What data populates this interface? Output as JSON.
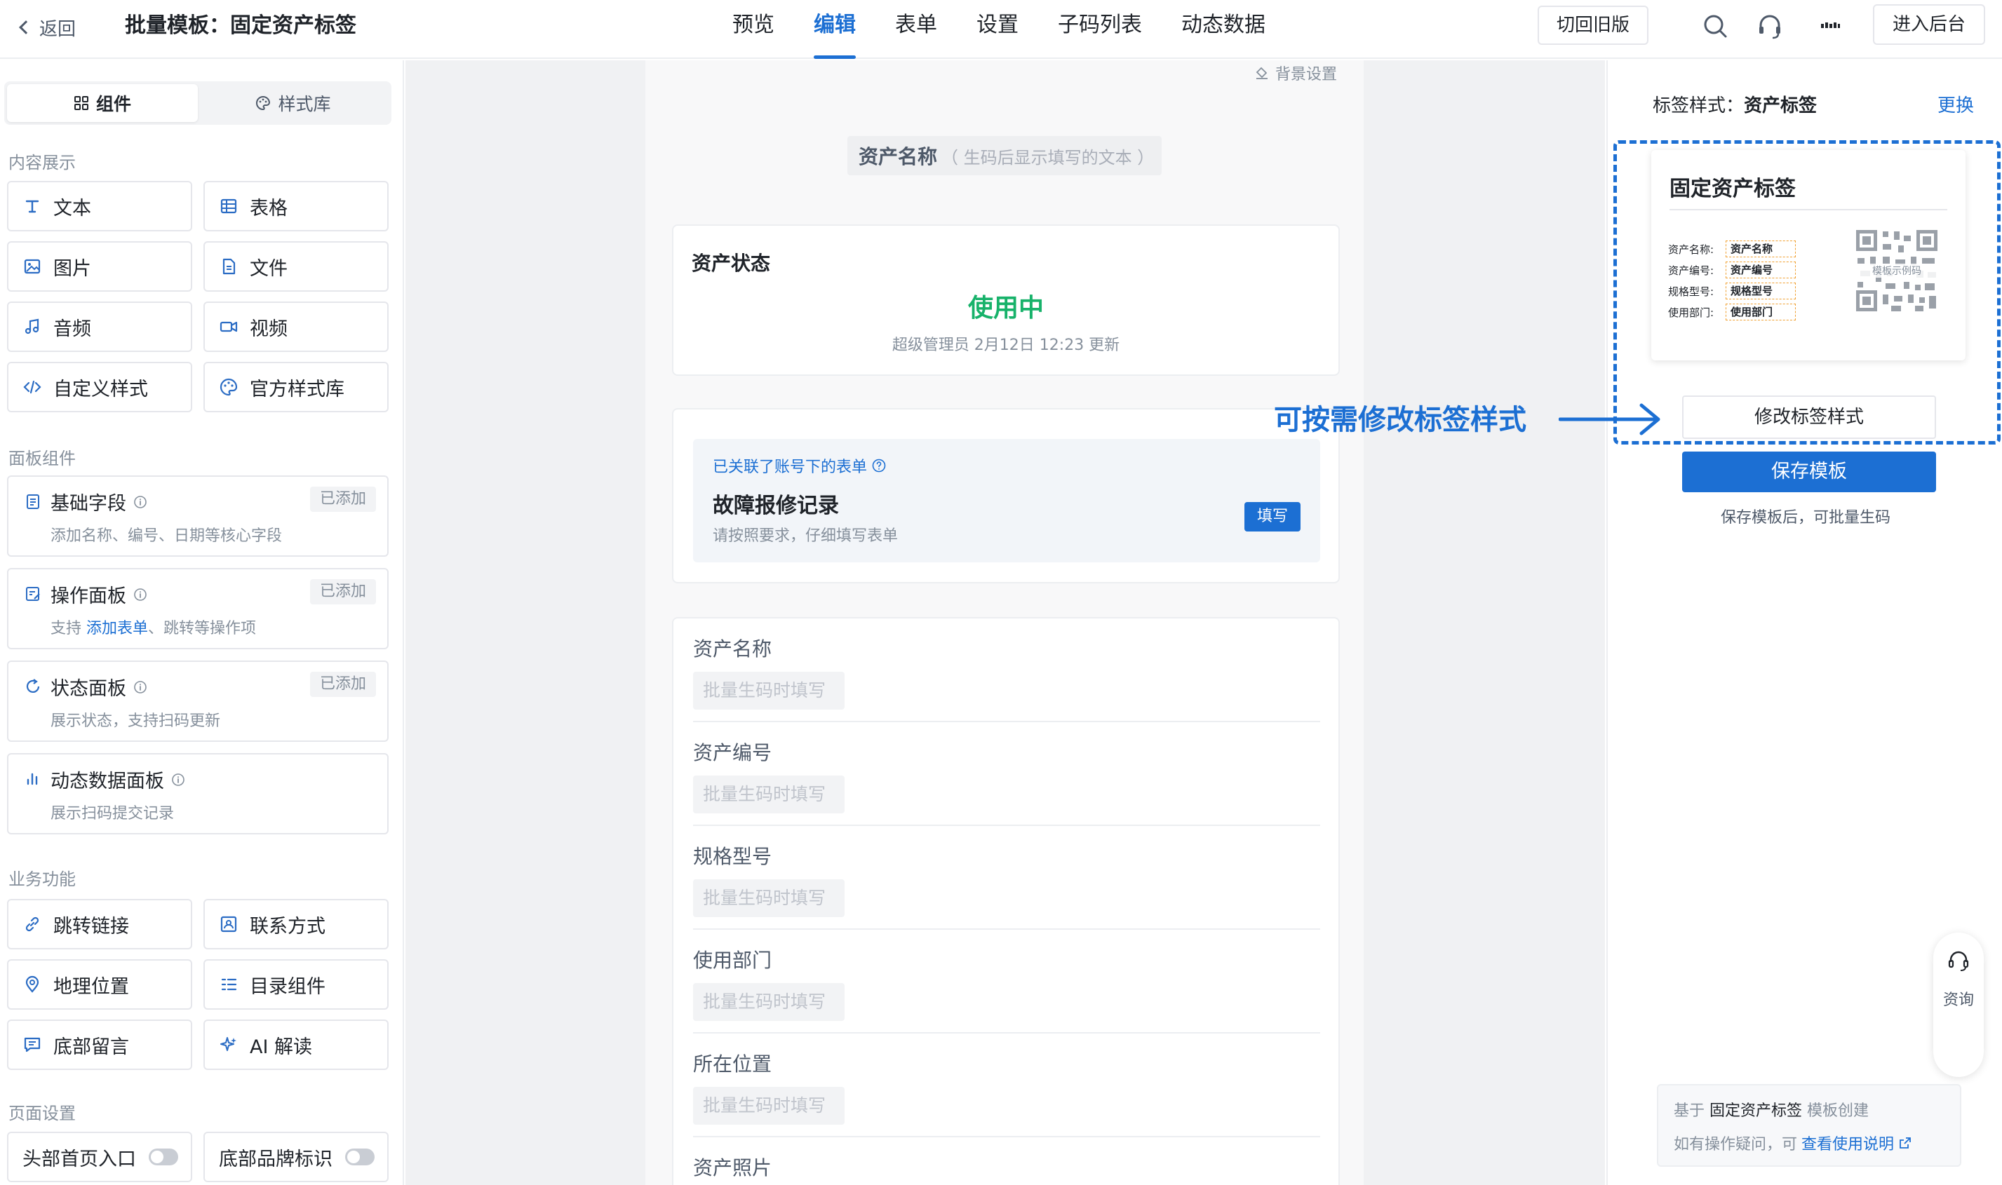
{
  "header": {
    "back_label": "返回",
    "title": "批量模板：固定资产标签",
    "tabs": [
      "预览",
      "编辑",
      "表单",
      "设置",
      "子码列表",
      "动态数据"
    ],
    "active_tab": "编辑",
    "old_version_label": "切回旧版",
    "admin_label": "进入后台"
  },
  "sidebar": {
    "tabs": {
      "components": "组件",
      "style_library": "样式库"
    },
    "sections": {
      "content": "内容展示",
      "panels": "面板组件",
      "business": "业务功能",
      "page": "页面设置"
    },
    "content_items": [
      "文本",
      "表格",
      "图片",
      "文件",
      "音频",
      "视频",
      "自定义样式",
      "官方样式库"
    ],
    "panel_items": [
      {
        "title": "基础字段",
        "desc": "添加名称、编号、日期等核心字段",
        "tag": "已添加"
      },
      {
        "title": "操作面板",
        "desc_prefix": "支持 ",
        "desc_link": "添加表单",
        "desc_suffix": "、跳转等操作项",
        "tag": "已添加"
      },
      {
        "title": "状态面板",
        "desc": "展示状态，支持扫码更新",
        "tag": "已添加"
      },
      {
        "title": "动态数据面板",
        "desc": "展示扫码提交记录",
        "tag": ""
      }
    ],
    "business_items": [
      "跳转链接",
      "联系方式",
      "地理位置",
      "目录组件",
      "底部留言",
      "AI 解读"
    ],
    "page_items": [
      "头部首页入口",
      "底部品牌标识"
    ]
  },
  "canvas": {
    "bg_setting": "背景设置",
    "name_chip": {
      "label": "资产名称",
      "hint": "（ 生码后显示填写的文本 ）"
    },
    "status": {
      "title": "资产状态",
      "value": "使用中",
      "meta": "超级管理员 2月12日 12:23 更新",
      "value_color": "#17b26a"
    },
    "form": {
      "linked": "已关联了账号下的表单",
      "name": "故障报修记录",
      "desc": "请按照要求，仔细填写表单",
      "button": "填写"
    },
    "fields": [
      {
        "label": "资产名称",
        "placeholder": "批量生码时填写"
      },
      {
        "label": "资产编号",
        "placeholder": "批量生码时填写"
      },
      {
        "label": "规格型号",
        "placeholder": "批量生码时填写"
      },
      {
        "label": "使用部门",
        "placeholder": "批量生码时填写"
      },
      {
        "label": "所在位置",
        "placeholder": "批量生码时填写"
      },
      {
        "label": "资产照片",
        "placeholder": ""
      }
    ]
  },
  "right": {
    "style_prefix": "标签样式：",
    "style_name": "资产标签",
    "change_label": "更换",
    "label_card": {
      "title": "固定资产标签",
      "rows": [
        {
          "key": "资产名称:",
          "value": "资产名称"
        },
        {
          "key": "资产编号:",
          "value": "资产编号"
        },
        {
          "key": "规格型号:",
          "value": "规格型号"
        },
        {
          "key": "使用部门:",
          "value": "使用部门"
        }
      ],
      "qr_text": "模板示例码"
    },
    "edit_style_button": "修改标签样式",
    "save_button": "保存模板",
    "save_hint": "保存模板后，可批量生码",
    "consult_label": "资询",
    "template_note": {
      "prefix": "基于 ",
      "template_name": "固定资产标签",
      "suffix": " 模板创建",
      "help_prefix": "如有操作疑问，可",
      "help_link": "查看使用说明"
    }
  },
  "annotation": "可按需修改标签样式",
  "colors": {
    "accent": "#1c6fd3",
    "status_green": "#17b26a"
  }
}
